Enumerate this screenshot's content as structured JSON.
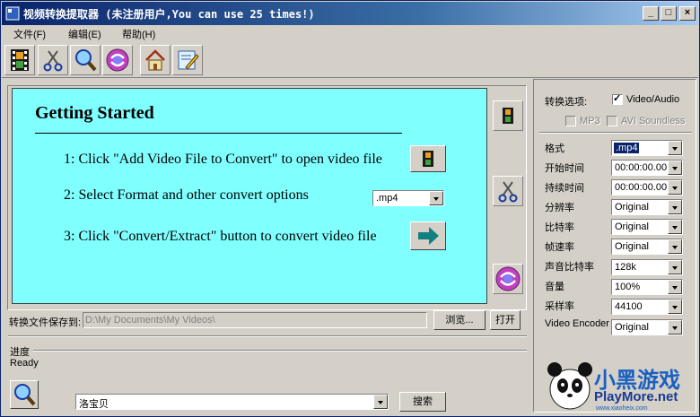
{
  "window": {
    "title": "视频转换提取器 (未注册用户,You can use 25 times!)",
    "buttons": {
      "minimize": "_",
      "maximize": "□",
      "close": "×"
    }
  },
  "menu": {
    "items": [
      "文件(F)",
      "编辑(E)",
      "帮助(H)"
    ]
  },
  "toolbar": {
    "icons": [
      "film-icon",
      "scissors-icon",
      "magnifier-icon",
      "convert-cd-icon",
      "home-icon",
      "edit-icon"
    ]
  },
  "guide": {
    "title": "Getting Started",
    "step1": "1: Click \"Add Video File to Convert\" to open video file",
    "step2": "2: Select Format and other convert options",
    "step2_format": ".mp4",
    "step3": "3: Click \"Convert/Extract\" button to convert video file"
  },
  "save": {
    "label": "转换文件保存到:",
    "path": "D:\\My Documents\\My Videos\\",
    "browse": "浏览...",
    "open": "打开"
  },
  "progress": {
    "label": "进度",
    "status": "Ready"
  },
  "search": {
    "value": "洛宝贝",
    "button": "搜索"
  },
  "options": {
    "label": "转换选项:",
    "video_audio": "Video/Audio",
    "mp3": "MP3",
    "avi_soundless": "AVI Soundless",
    "fields": [
      {
        "label": "格式",
        "value": ".mp4"
      },
      {
        "label": "开始时间",
        "value": "00:00:00.00"
      },
      {
        "label": "持续时间",
        "value": "00:00:00.00"
      },
      {
        "label": "分辨率",
        "value": "Original"
      },
      {
        "label": "比特率",
        "value": "Original"
      },
      {
        "label": "帧速率",
        "value": "Original"
      },
      {
        "label": "声音比特率",
        "value": "128k"
      },
      {
        "label": "音量",
        "value": "100%"
      },
      {
        "label": "采样率",
        "value": "44100"
      },
      {
        "label": "Video Encoder",
        "value": "Original"
      }
    ]
  },
  "watermark": {
    "text1": "小黑游戏",
    "text2": "PlayMore.net",
    "text3": "www.xiaoheix.com"
  },
  "colors": {
    "title_bar": "#0a246a",
    "panel": "#80ffff",
    "face": "#d4d0c8"
  }
}
